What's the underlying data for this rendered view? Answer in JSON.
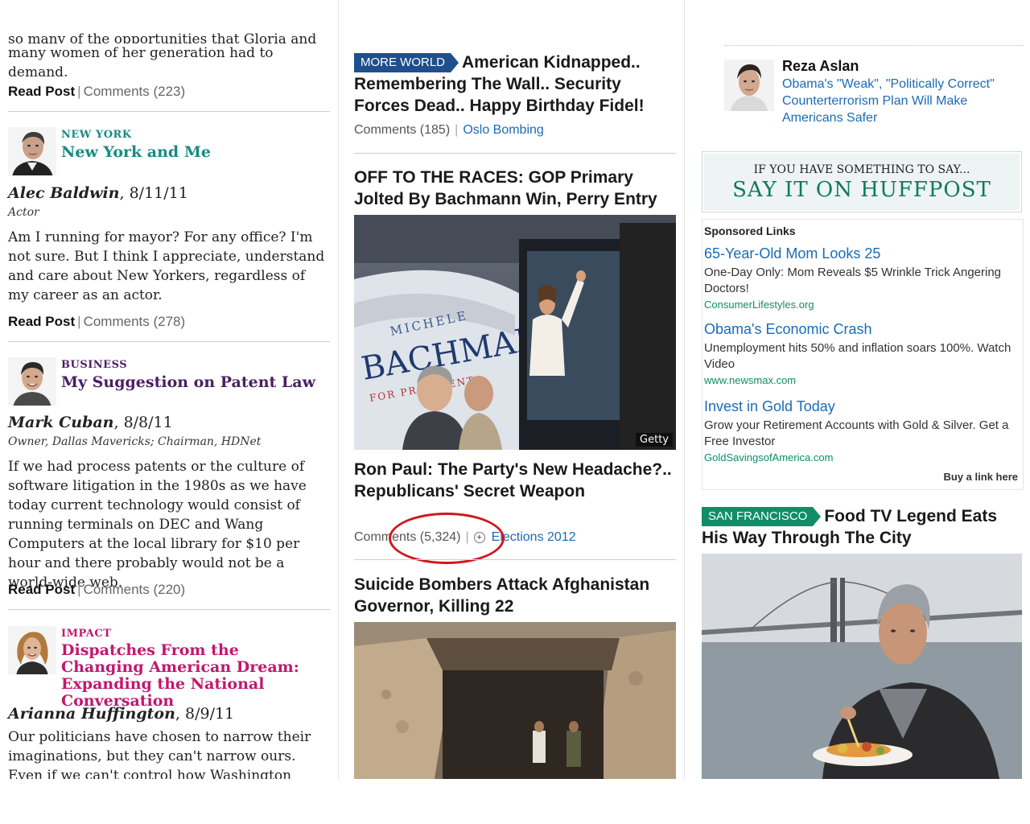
{
  "left": {
    "cut_top_line1": "so many of the opportunities that Gloria and",
    "cut_top_line2": "many women of her generation had to demand.",
    "read_post": "Read Post",
    "separator": "|",
    "post1_comments": "Comments (223)",
    "posts": [
      {
        "section": "NEW YORK",
        "title": "New York and Me",
        "author": "Alec Baldwin",
        "date": ", 8/11/11",
        "role": "Actor",
        "body": "Am I running for mayor? For any office? I'm not sure. But I think I appreciate, understand and care about New Yorkers, regardless of my career as an actor.",
        "comments": "Comments (278)",
        "section_color": "#1a8a83",
        "title_color": "#1a8a83"
      },
      {
        "section": "BUSINESS",
        "title": "My Suggestion on Patent Law",
        "author": "Mark Cuban",
        "date": ", 8/8/11",
        "role": "Owner, Dallas Mavericks; Chairman, HDNet",
        "body": "If we had process patents or the culture of software litigation in the 1980s as we have today current technology would consist of running terminals on DEC and Wang Computers at the local library for $10 per hour and there probably would not be a world-wide web.",
        "comments": "Comments (220)",
        "section_color": "#4a1f63",
        "title_color": "#4a1f63"
      },
      {
        "section": "IMPACT",
        "title": "Dispatches From the Changing American Dream: Expanding the National Conversation",
        "author": "Arianna Huffington",
        "date": ", 8/9/11",
        "body": "Our politicians have chosen to narrow their imaginations, but they can't narrow ours. Even if we can't control how Washington responds to",
        "section_color": "#c2176f",
        "title_color": "#c2176f"
      }
    ]
  },
  "middle": {
    "story1": {
      "tag": "MORE WORLD",
      "title": "American Kidnapped.. Remembering The Wall.. Security Forces Dead.. Happy Birthday Fidel!",
      "comments": "Comments (185)",
      "link": "Oslo Bombing"
    },
    "story2": {
      "title": "OFF TO THE RACES: GOP Primary Jolted By Bachmann Win, Perry Entry",
      "credit": "Getty",
      "bus_text1": "MICHELE",
      "bus_text2": "BACHMANN",
      "bus_text3": "FOR PRESIDENT",
      "subtitle": "Ron Paul: The Party's New Headache?.. Republicans' Secret Weapon",
      "comments": "Comments (5,324)",
      "link": "Elections 2012"
    },
    "story3": {
      "title": "Suicide Bombers Attack Afghanistan Governor, Killing 22"
    }
  },
  "right": {
    "blogger": {
      "name": "Reza Aslan",
      "link": "Obama's \"Weak\", \"Politically Correct\" Counterterrorism Plan Will Make Americans Safer"
    },
    "promo_small": "IF YOU HAVE SOMETHING TO SAY...",
    "promo_big": "SAY IT ON HUFFPOST",
    "sponsored_heading": "Sponsored Links",
    "ads": [
      {
        "title": "65-Year-Old Mom Looks 25",
        "desc": "One-Day Only: Mom Reveals $5 Wrinkle Trick Angering Doctors!",
        "url": "ConsumerLifestyles.org"
      },
      {
        "title": "Obama's Economic Crash",
        "desc": "Unemployment hits 50% and inflation soars 100%. Watch Video",
        "url": "www.newsmax.com"
      },
      {
        "title": "Invest in Gold Today",
        "desc": "Grow your Retirement Accounts with Gold & Silver. Get a Free Investor",
        "url": "GoldSavingsofAmerica.com"
      }
    ],
    "buy_link": "Buy a link here",
    "sf": {
      "tag": "SAN FRANCISCO",
      "title": "Food TV Legend Eats His Way Through The City"
    }
  },
  "colors": {
    "accent_blue": "#1f4f8c",
    "accent_green": "#0f8e68",
    "link_blue": "#1a6bb8",
    "annotation_red": "#d0181e"
  }
}
